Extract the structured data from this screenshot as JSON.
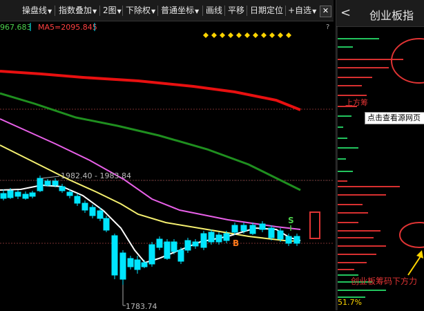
{
  "toolbar": {
    "buttons": [
      {
        "label": "操盘线",
        "has_arrow": true
      },
      {
        "label": "指数叠加",
        "has_arrow": true
      },
      {
        "label": "2图",
        "has_arrow": true
      },
      {
        "label": "下除权",
        "has_arrow": true
      },
      {
        "label": "普通坐标",
        "has_arrow": true
      },
      {
        "label": "画线",
        "has_arrow": false
      },
      {
        "label": "平移",
        "has_arrow": false
      },
      {
        "label": "日期定位",
        "has_arrow": false
      },
      {
        "label": "+自选",
        "has_arrow": true
      }
    ],
    "arrow_glyph": "▼",
    "close_label": "✕"
  },
  "legend": {
    "ma_partial": "967.683",
    "ma5": "MA5=2095.845",
    "question": "?"
  },
  "price_labels": {
    "range": "1982.40 - 1983.84",
    "low": "1783.74"
  },
  "markers": {
    "s": "S",
    "b": "B"
  },
  "sidebar": {
    "back_icon": "<",
    "title": "创业板指",
    "tooltip": "点击查看源网页",
    "red_partial": "上方筹",
    "annotation": "创业板筹码下方力",
    "percentage": "51.7%"
  },
  "colors": {
    "up": "#ff3a3a",
    "down": "#00e5ff",
    "ma_red": "#e81010",
    "ma_green": "#1f8f1f",
    "ma_magenta": "#e860e8",
    "ma_yellow": "#f5f070",
    "ma_white": "#ffffff",
    "diamond": "#ffd400",
    "chip_green": "#22c55e",
    "chip_red": "#d83030"
  }
}
